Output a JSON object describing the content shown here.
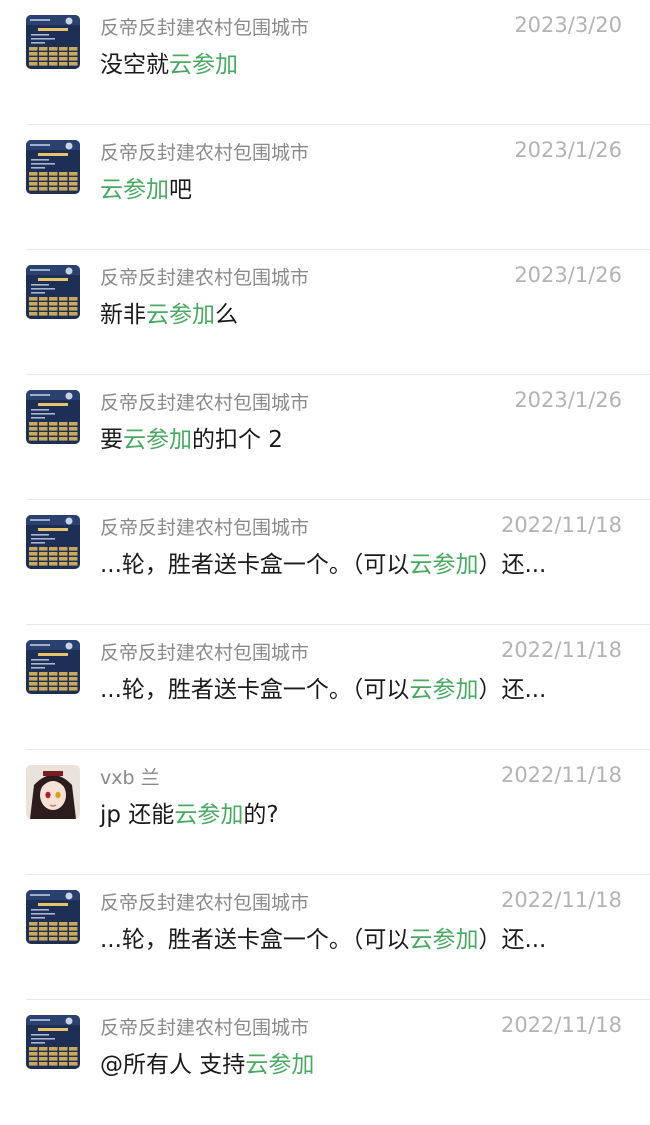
{
  "highlight_color": "#4aa862",
  "results": [
    {
      "avatar_type": "poster",
      "name": "反帝反封建农村包围城市",
      "date": "2023/3/20",
      "message": {
        "before": "没空就",
        "keyword": "云参加",
        "after": ""
      }
    },
    {
      "avatar_type": "poster",
      "name": "反帝反封建农村包围城市",
      "date": "2023/1/26",
      "message": {
        "before": "",
        "keyword": "云参加",
        "after": "吧"
      }
    },
    {
      "avatar_type": "poster",
      "name": "反帝反封建农村包围城市",
      "date": "2023/1/26",
      "message": {
        "before": "新非",
        "keyword": "云参加",
        "after": "么"
      }
    },
    {
      "avatar_type": "poster",
      "name": "反帝反封建农村包围城市",
      "date": "2023/1/26",
      "message": {
        "before": "要",
        "keyword": "云参加",
        "after": "的扣个 2"
      }
    },
    {
      "avatar_type": "poster",
      "name": "反帝反封建农村包围城市",
      "date": "2022/11/18",
      "message": {
        "before": "...轮，胜者送卡盒一个。（可以",
        "keyword": "云参加",
        "after": "）还..."
      }
    },
    {
      "avatar_type": "poster",
      "name": "反帝反封建农村包围城市",
      "date": "2022/11/18",
      "message": {
        "before": "...轮，胜者送卡盒一个。（可以",
        "keyword": "云参加",
        "after": "）还..."
      }
    },
    {
      "avatar_type": "anime-girl",
      "name": "vxb 兰",
      "date": "2022/11/18",
      "message": {
        "before": "jp 还能",
        "keyword": "云参加",
        "after": "的?"
      }
    },
    {
      "avatar_type": "poster",
      "name": "反帝反封建农村包围城市",
      "date": "2022/11/18",
      "message": {
        "before": "...轮，胜者送卡盒一个。（可以",
        "keyword": "云参加",
        "after": "）还..."
      }
    },
    {
      "avatar_type": "poster",
      "name": "反帝反封建农村包围城市",
      "date": "2022/11/18",
      "message": {
        "before": "@所有人 支持",
        "keyword": "云参加",
        "after": ""
      }
    }
  ]
}
